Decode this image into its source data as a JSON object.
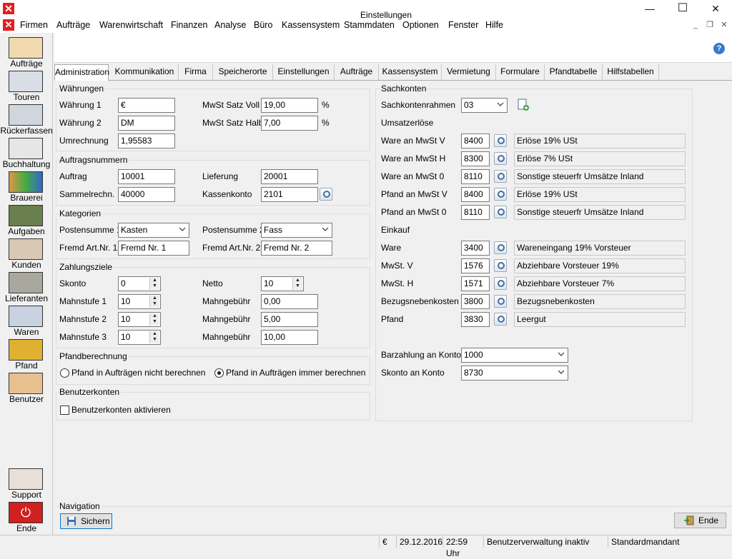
{
  "window": {
    "minimize": "—",
    "maximize": "☐",
    "close": "✕"
  },
  "menu": [
    "Firmen",
    "Aufträge",
    "Warenwirtschaft",
    "Finanzen",
    "Analyse",
    "Büro",
    "Kassensystem",
    "Stammdaten",
    "Optionen",
    "Fenster",
    "Hilfe"
  ],
  "mdi": {
    "minimize": "_",
    "restore": "❐",
    "close": "✕"
  },
  "sidebar": [
    "Aufträge",
    "Touren",
    "Rückerfassen",
    "Buchhaltung",
    "Brauerei",
    "Aufgaben",
    "Kunden",
    "Lieferanten",
    "Waren",
    "Pfand",
    "Benutzer",
    "Support",
    "Ende"
  ],
  "header": {
    "title": "Einstellungen",
    "help": "?"
  },
  "tabs": [
    "Administration",
    "Kommunikation",
    "Firma",
    "Speicherorte",
    "Einstellungen",
    "Aufträge",
    "Kassensystem",
    "Vermietung",
    "Formulare",
    "Pfandtabelle",
    "Hilfstabellen"
  ],
  "waehrungen": {
    "title": "Währungen",
    "w1_label": "Währung 1",
    "w1": "€",
    "w2_label": "Währung 2",
    "w2": "DM",
    "umr_label": "Umrechnung",
    "umr": "1,95583",
    "mwst_voll_label": "MwSt Satz Voll",
    "mwst_voll": "19,00",
    "mwst_halb_label": "MwSt Satz Halb",
    "mwst_halb": "7,00",
    "pct": "%"
  },
  "auftragsnummern": {
    "title": "Auftragsnummern",
    "auftrag_label": "Auftrag",
    "auftrag": "10001",
    "sammel_label": "Sammelrechn.",
    "sammel": "40000",
    "lieferung_label": "Lieferung",
    "lieferung": "20001",
    "kasse_label": "Kassenkonto",
    "kasse": "2101"
  },
  "kategorien": {
    "title": "Kategorien",
    "ps1_label": "Postensumme 1",
    "ps1": "Kasten",
    "ps2_label": "Postensumme 2",
    "ps2": "Fass",
    "fa1_label": "Fremd Art.Nr. 1",
    "fa1": "Fremd Nr. 1",
    "fa2_label": "Fremd Art.Nr. 2",
    "fa2": "Fremd Nr. 2"
  },
  "zahlungsziele": {
    "title": "Zahlungsziele",
    "skonto_label": "Skonto",
    "skonto": "0",
    "netto_label": "Netto",
    "netto": "10",
    "m1_label": "Mahnstufe 1",
    "m1": "10",
    "m2_label": "Mahnstufe 2",
    "m2": "10",
    "m3_label": "Mahnstufe 3",
    "m3": "10",
    "g_label": "Mahngebühr",
    "g1": "0,00",
    "g2": "5,00",
    "g3": "10,00"
  },
  "pfand": {
    "title": "Pfandberechnung",
    "opt1": "Pfand in Aufträgen nicht berechnen",
    "opt2": "Pfand in Aufträgen immer berechnen"
  },
  "benutzer": {
    "title": "Benutzerkonten",
    "check": "Benutzerkonten aktivieren"
  },
  "sachkonten": {
    "title": "Sachkonten",
    "rahmen_label": "Sachkontenrahmen",
    "rahmen": "03",
    "umsatz_title": "Umsatzerlöse",
    "umsatz": [
      {
        "label": "Ware an MwSt V",
        "num": "8400",
        "desc": "Erlöse 19% USt"
      },
      {
        "label": "Ware an MwSt H",
        "num": "8300",
        "desc": "Erlöse 7% USt"
      },
      {
        "label": "Ware an MwSt 0",
        "num": "8110",
        "desc": "Sonstige steuerfr Umsätze Inland"
      },
      {
        "label": "Pfand an MwSt V",
        "num": "8400",
        "desc": "Erlöse 19% USt"
      },
      {
        "label": "Pfand an MwSt 0",
        "num": "8110",
        "desc": "Sonstige steuerfr Umsätze Inland"
      }
    ],
    "einkauf_title": "Einkauf",
    "einkauf": [
      {
        "label": "Ware",
        "num": "3400",
        "desc": "Wareneingang 19% Vorsteuer"
      },
      {
        "label": "MwSt. V",
        "num": "1576",
        "desc": "Abziehbare Vorsteuer 19%"
      },
      {
        "label": "MwSt. H",
        "num": "1571",
        "desc": "Abziehbare Vorsteuer 7%"
      },
      {
        "label": "Bezugsnebenkosten",
        "num": "3800",
        "desc": "Bezugsnebenkosten"
      },
      {
        "label": "Pfand",
        "num": "3830",
        "desc": "Leergut"
      }
    ],
    "bar_label": "Barzahlung an Konto",
    "bar": "1000",
    "skonto_label": "Skonto an Konto",
    "skonto": "8730"
  },
  "navigation": {
    "title": "Navigation",
    "save": "Sichern",
    "end": "Ende"
  },
  "status": {
    "currency": "€",
    "date": "29.12.2016",
    "time": "22:59 Uhr",
    "user": "Benutzerverwaltung inaktiv",
    "mandant": "Standardmandant"
  }
}
